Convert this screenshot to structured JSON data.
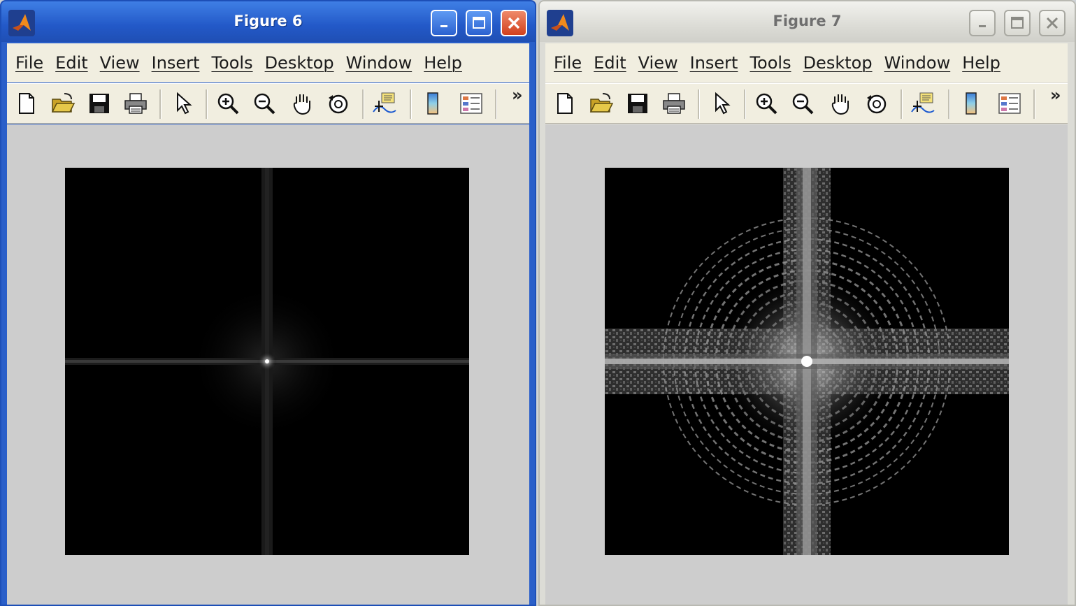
{
  "windows": [
    {
      "title": "Figure 6",
      "menu": [
        "File",
        "Edit",
        "View",
        "Insert",
        "Tools",
        "Desktop",
        "Window",
        "Help"
      ],
      "toolbar_more": "»",
      "state": "active"
    },
    {
      "title": "Figure 7",
      "menu": [
        "File",
        "Edit",
        "View",
        "Insert",
        "Tools",
        "Desktop",
        "Window",
        "Help"
      ],
      "toolbar_more": "»",
      "state": "inactive"
    }
  ],
  "toolbar_icons": [
    "new-figure-icon",
    "open-file-icon",
    "save-icon",
    "print-icon",
    "pointer-icon",
    "zoom-in-icon",
    "zoom-out-icon",
    "pan-hand-icon",
    "rotate-3d-icon",
    "data-cursor-icon",
    "colorbar-icon",
    "legend-icon"
  ],
  "colors": {
    "active_titlebar": "#2359c8",
    "inactive_titlebar": "#dcdcd6",
    "menubar": "#f1eee0",
    "figure_bg": "#cdcdcd",
    "image_bg": "#000000"
  }
}
